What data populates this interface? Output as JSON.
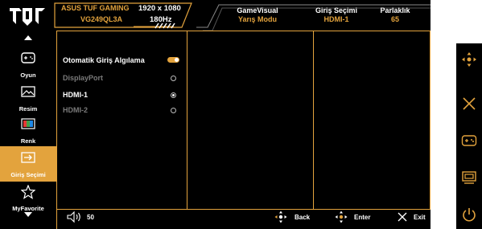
{
  "brand": {
    "logo_icon": "tuf-logo-icon"
  },
  "header": {
    "model_line1": "ASUS TUF GAMING",
    "model_line2": "VG249QL3A",
    "resolution": "1920 x 1080",
    "refresh": "180Hz",
    "gamevisual_label": "GameVisual",
    "gamevisual_value": "Yarış Modu",
    "input_label": "Giriş Seçimi",
    "input_value": "HDMI-1",
    "brightness_label": "Parlaklık",
    "brightness_value": "65"
  },
  "sidebar": {
    "items": [
      {
        "label": "Oyun",
        "icon": "gamepad-icon"
      },
      {
        "label": "Resim",
        "icon": "picture-icon"
      },
      {
        "label": "Renk",
        "icon": "color-bars-icon"
      },
      {
        "label": "Giriş Seçimi",
        "icon": "input-select-icon"
      },
      {
        "label": "MyFavorite",
        "icon": "star-icon"
      }
    ],
    "active_index": 3
  },
  "options": {
    "auto_detect": "Otomatik Giriş Algılama",
    "displayport": "DisplayPort",
    "hdmi1": "HDMI-1",
    "hdmi2": "HDMI-2",
    "auto_detect_on": true,
    "selected": "HDMI-1"
  },
  "footer": {
    "volume_value": "50",
    "back_label": "Back",
    "enter_label": "Enter",
    "exit_label": "Exit"
  },
  "accent_color": "#e3a33d",
  "right_buttons": [
    "navigate-joystick-icon",
    "close-icon",
    "gamepad-plus-icon",
    "input-switch-icon",
    "power-icon"
  ]
}
